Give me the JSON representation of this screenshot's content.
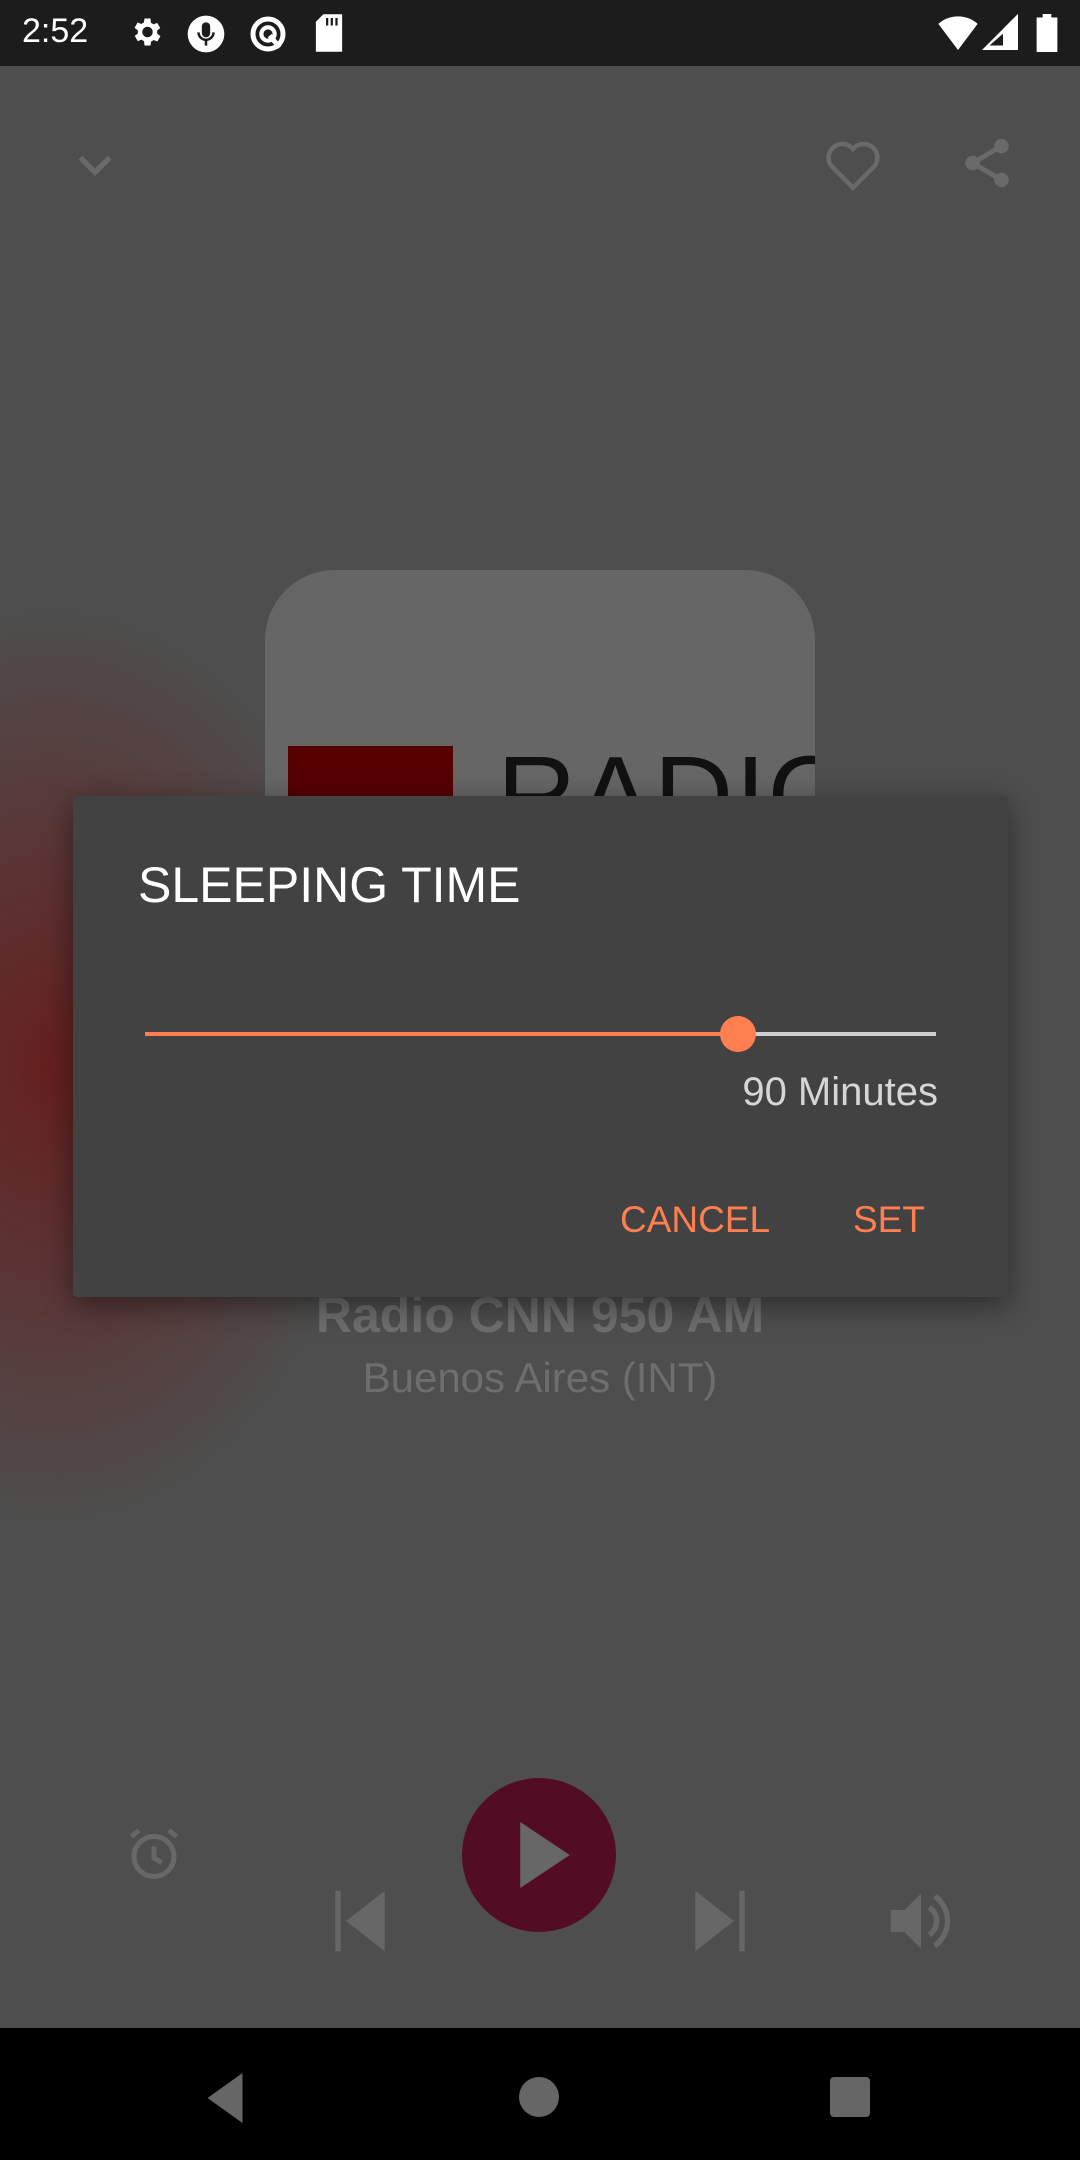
{
  "status_bar": {
    "time": "2:52",
    "icons": [
      "gear-icon",
      "mic-icon",
      "vpn-icon",
      "sd-card-icon"
    ],
    "right_icons": [
      "wifi-icon",
      "signal-icon",
      "battery-icon"
    ]
  },
  "top_bar": {
    "icons": [
      "chevron-down-icon",
      "heart-outline-icon",
      "share-icon"
    ]
  },
  "artwork": {
    "logo_text": "RADIO"
  },
  "station": {
    "name": "Radio CNN 950 AM",
    "location": "Buenos Aires (INT)"
  },
  "controls": {
    "icons": [
      "alarm-icon",
      "skip-previous-icon",
      "play-icon",
      "skip-next-icon",
      "volume-icon"
    ],
    "play_color": "#520c24"
  },
  "dialog": {
    "title": "SLEEPING TIME",
    "slider_fraction": 0.75,
    "value_label": "90 Minutes",
    "cancel_label": "CANCEL",
    "set_label": "SET",
    "accent_color": "#ff7f50"
  },
  "nav_bar": {
    "icons": [
      "back-icon",
      "home-icon",
      "recents-icon"
    ]
  }
}
